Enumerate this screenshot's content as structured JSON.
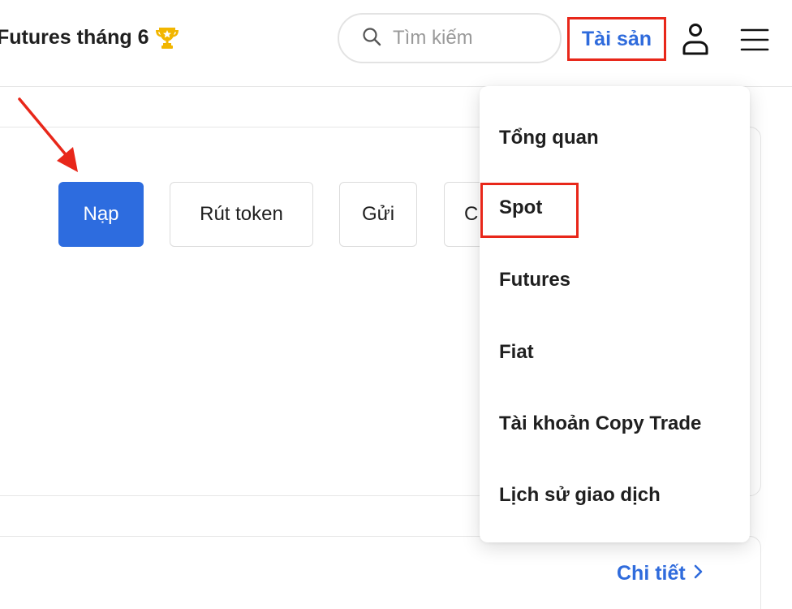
{
  "header": {
    "promo_text": "Futures tháng 6",
    "promo_icon": "trophy-icon",
    "search_placeholder": "Tìm kiếm",
    "search_icon": "search-icon",
    "assets_label": "Tài sản",
    "user_icon": "user-icon",
    "menu_icon": "hamburger-menu-icon"
  },
  "actions": {
    "deposit": "Nạp",
    "withdraw": "Rút token",
    "send": "Gửi",
    "partial": "C"
  },
  "detail_link": {
    "label": "Chi tiết",
    "icon": "chevron-right-icon"
  },
  "dropdown": {
    "items": [
      {
        "label": "Tổng quan"
      },
      {
        "label": "Spot"
      },
      {
        "label": "Futures"
      },
      {
        "label": "Fiat"
      },
      {
        "label": "Tài khoản Copy Trade"
      },
      {
        "label": "Lịch sử giao dịch"
      }
    ]
  },
  "colors": {
    "accent_blue": "#2d6cdf",
    "link_blue": "#2f6bdc",
    "annotation_red": "#e8271a",
    "trophy_gold": "#f2b600"
  }
}
